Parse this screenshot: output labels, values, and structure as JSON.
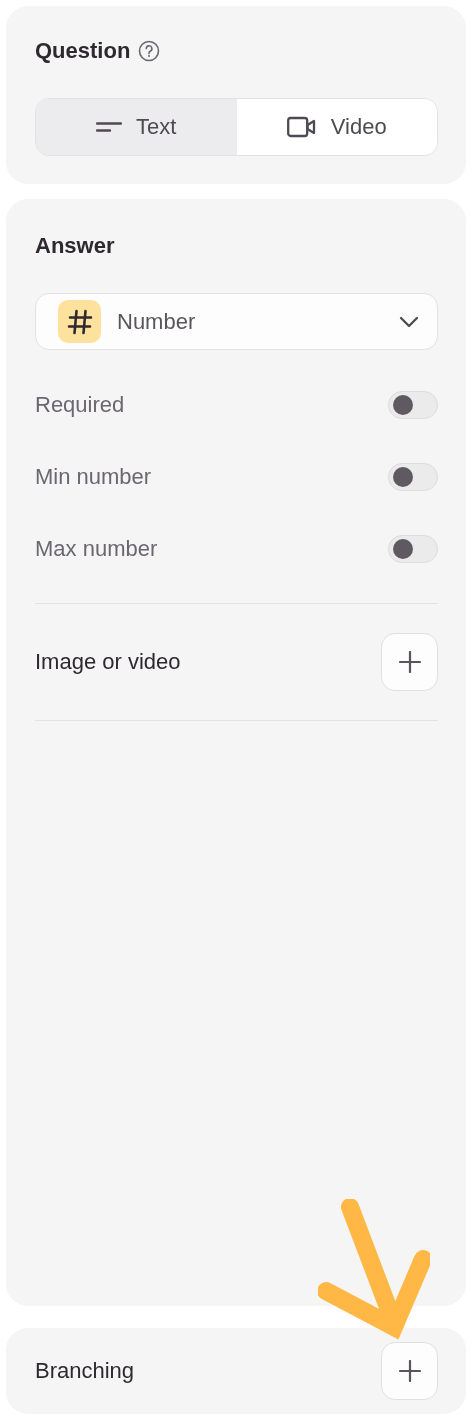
{
  "question": {
    "title": "Question",
    "tabs": [
      {
        "label": "Text",
        "kind": "text",
        "selected": true
      },
      {
        "label": "Video",
        "kind": "video",
        "selected": false
      }
    ]
  },
  "answer": {
    "title": "Answer",
    "type": {
      "label": "Number"
    },
    "settings": [
      {
        "label": "Required",
        "on": false
      },
      {
        "label": "Min number",
        "on": false
      },
      {
        "label": "Max number",
        "on": false
      }
    ],
    "media": {
      "label": "Image or video"
    }
  },
  "branching": {
    "label": "Branching"
  }
}
